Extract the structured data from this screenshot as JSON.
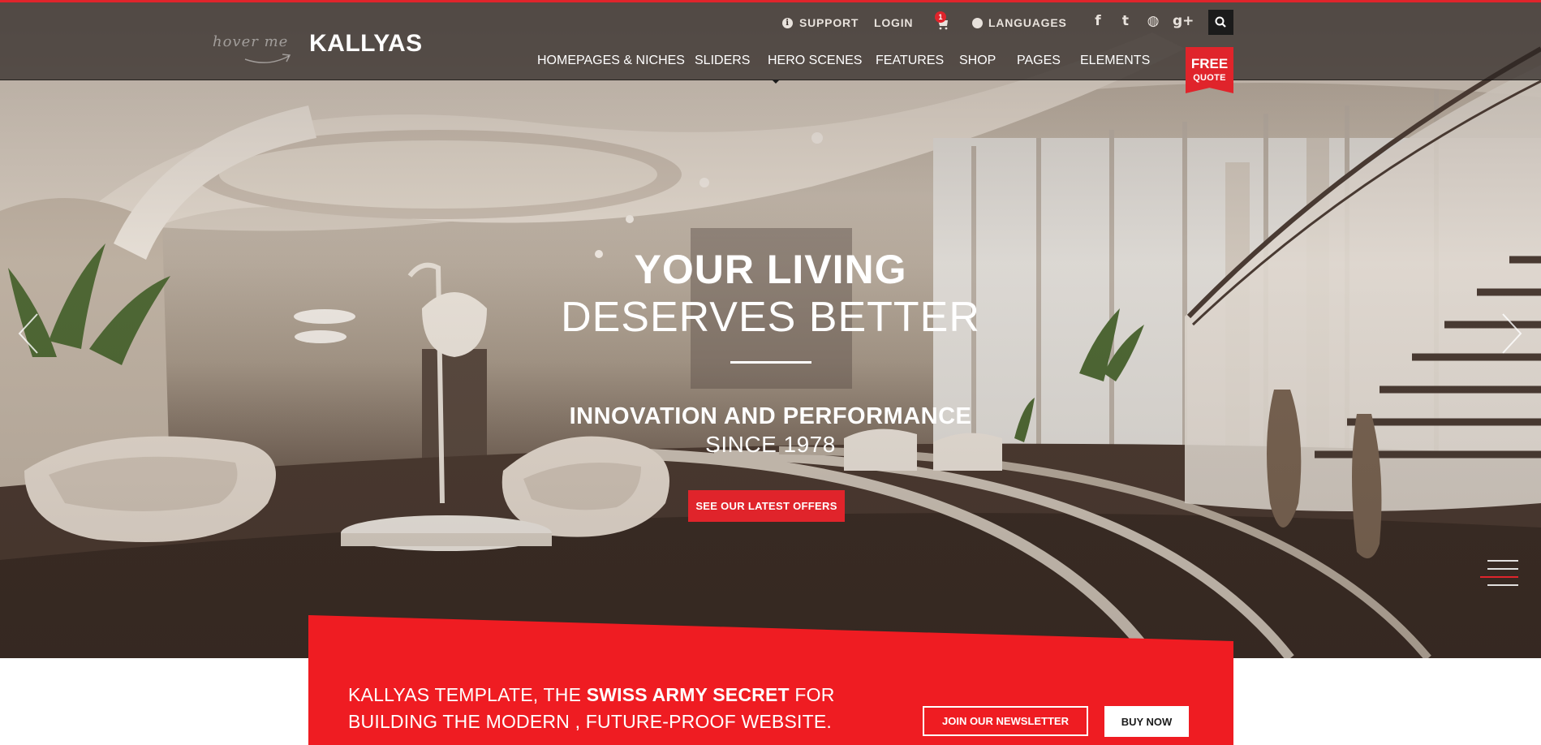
{
  "header": {
    "hover_hint": "hover me",
    "logo": "KALLYAS",
    "topbar": {
      "support": "SUPPORT",
      "login": "LOGIN",
      "cart_count": "1",
      "languages": "LANGUAGES"
    },
    "social": [
      {
        "icon": "facebook-icon",
        "glyph": "f"
      },
      {
        "icon": "twitter-icon",
        "glyph": "t"
      },
      {
        "icon": "dribbble-icon",
        "glyph": "◍"
      },
      {
        "icon": "google-plus-icon",
        "glyph": "g+"
      }
    ],
    "nav": [
      "HOMEPAGES & NICHES",
      "SLIDERS",
      "HERO SCENES",
      "FEATURES",
      "SHOP",
      "PAGES",
      "ELEMENTS"
    ],
    "free_quote": {
      "line1": "FREE",
      "line2": "QUOTE"
    }
  },
  "hero": {
    "title_line1": "YOUR LIVING",
    "title_line2": "DESERVES BETTER",
    "subtitle_line1": "INNOVATION AND PERFORMANCE",
    "subtitle_line2": "SINCE 1978",
    "cta": "SEE OUR LATEST OFFERS"
  },
  "promo": {
    "text_part1": "KALLYAS TEMPLATE, THE ",
    "text_bold": "SWISS ARMY SECRET",
    "text_part2": " FOR",
    "text_line2": "BUILDING THE MODERN , FUTURE-PROOF WEBSITE.",
    "newsletter_button": "JOIN OUR NEWSLETTER",
    "buy_button": "BUY NOW"
  },
  "colors": {
    "accent": "#e0242b",
    "promo": "#ef1c22",
    "header_overlay": "#2d2622"
  }
}
